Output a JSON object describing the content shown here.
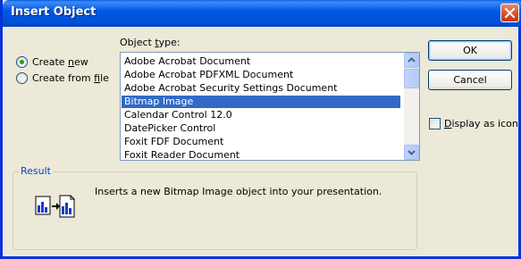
{
  "window": {
    "title": "Insert Object"
  },
  "options": {
    "create_new": {
      "label_pre": "Create ",
      "accel": "n",
      "label_post": "ew",
      "selected": true
    },
    "create_from_file": {
      "label_pre": "Create from ",
      "accel": "f",
      "label_post": "ile",
      "selected": false
    }
  },
  "object_type": {
    "label_pre": "Object ",
    "accel": "t",
    "label_post": "ype:",
    "items": [
      "Adobe Acrobat Document",
      "Adobe Acrobat PDFXML Document",
      "Adobe Acrobat Security Settings Document",
      "Bitmap Image",
      "Calendar Control 12.0",
      "DatePicker Control",
      "Foxit FDF Document",
      "Foxit Reader Document"
    ],
    "selected": "Bitmap Image"
  },
  "buttons": {
    "ok": "OK",
    "cancel": "Cancel"
  },
  "display_as_icon": {
    "accel": "D",
    "label_post": "isplay as icon",
    "checked": false
  },
  "result": {
    "legend": "Result",
    "description": "Inserts a new Bitmap Image object into your presentation."
  },
  "colors": {
    "title_bar": "#0058e6",
    "selection": "#316ac5",
    "face": "#ece9d8"
  },
  "icons": [
    "close-icon",
    "scroll-up-arrow-icon",
    "scroll-down-arrow-icon",
    "result-object-icon"
  ]
}
